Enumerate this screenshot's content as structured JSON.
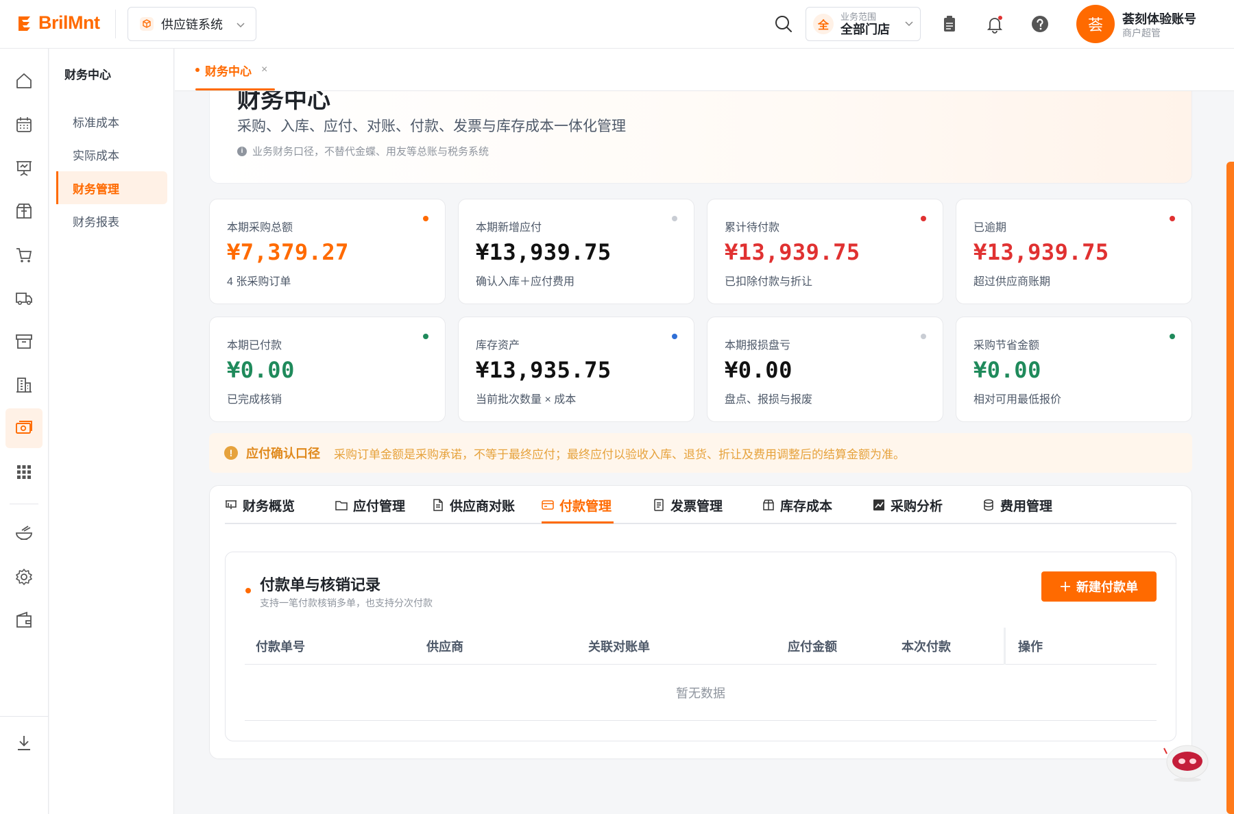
{
  "brand": {
    "name": "BrilMnt",
    "accent": "#ff6a00"
  },
  "header": {
    "system": "供应链系统",
    "scope_label": "业务范围",
    "scope_value": "全部门店",
    "scope_badge": "全",
    "user_avatar": "荟",
    "user_name": "荟刻体验账号",
    "user_role": "商户超管",
    "icons": [
      "search-icon",
      "clipboard-icon",
      "bell-icon",
      "help-icon"
    ]
  },
  "rail": {
    "items": [
      "home-icon",
      "calendar-icon",
      "presentation-icon",
      "package-icon",
      "cart-icon",
      "truck-icon",
      "archive-icon",
      "building-icon",
      "finance-icon",
      "apps-grid-icon",
      "bowl-icon",
      "settings-icon",
      "wallet-icon",
      "download-icon"
    ],
    "active": "finance-icon"
  },
  "subnav": {
    "title": "财务中心",
    "items": [
      {
        "label": "标准成本"
      },
      {
        "label": "实际成本"
      },
      {
        "label": "财务管理",
        "active": true
      },
      {
        "label": "财务报表"
      }
    ]
  },
  "page_tab": {
    "label": "财务中心",
    "close": "×"
  },
  "hero": {
    "title": "财务中心",
    "subtitle": "采购、入库、应付、对账、付款、发票与库存成本一体化管理",
    "note": "业务财务口径，不替代金蝶、用友等总账与税务系统"
  },
  "stats": [
    {
      "label": "本期采购总额",
      "value": "¥7,379.27",
      "desc": "4 张采购订单",
      "color": "#ff6a00",
      "dot": "#ff6a00"
    },
    {
      "label": "本期新增应付",
      "value": "¥13,939.75",
      "desc": "确认入库＋应付费用",
      "color": "#111111",
      "dot": "#c9cdd4"
    },
    {
      "label": "累计待付款",
      "value": "¥13,939.75",
      "desc": "已扣除付款与折让",
      "color": "#e03131",
      "dot": "#e03131"
    },
    {
      "label": "已逾期",
      "value": "¥13,939.75",
      "desc": "超过供应商账期",
      "color": "#e03131",
      "dot": "#e03131"
    },
    {
      "label": "本期已付款",
      "value": "¥0.00",
      "desc": "已完成核销",
      "color": "#1f8a5b",
      "dot": "#1f8a5b"
    },
    {
      "label": "库存资产",
      "value": "¥13,935.75",
      "desc": "当前批次数量 × 成本",
      "color": "#111111",
      "dot": "#2f6fd6"
    },
    {
      "label": "本期报损盘亏",
      "value": "¥0.00",
      "desc": "盘点、报损与报废",
      "color": "#111111",
      "dot": "#c9cdd4"
    },
    {
      "label": "采购节省金额",
      "value": "¥0.00",
      "desc": "相对可用最低报价",
      "color": "#1f8a5b",
      "dot": "#1f8a5b"
    }
  ],
  "alert": {
    "title": "应付确认口径",
    "text": "采购订单金额是采购承诺，不等于最终应付；最终应付以验收入库、退货、折让及费用调整后的结算金额为准。"
  },
  "tabs": [
    {
      "label": "财务概览",
      "icon": "presentation-icon"
    },
    {
      "label": "应付管理",
      "icon": "folder-icon"
    },
    {
      "label": "供应商对账",
      "icon": "document-icon"
    },
    {
      "label": "付款管理",
      "icon": "card-icon",
      "active": true
    },
    {
      "label": "发票管理",
      "icon": "invoice-icon"
    },
    {
      "label": "库存成本",
      "icon": "box-icon"
    },
    {
      "label": "采购分析",
      "icon": "chart-icon"
    },
    {
      "label": "费用管理",
      "icon": "database-icon"
    }
  ],
  "payments": {
    "title": "付款单与核销记录",
    "subtitle": "支持一笔付款核销多单，也支持分次付款",
    "new_button": "新建付款单",
    "columns": [
      "付款单号",
      "供应商",
      "关联对账单",
      "应付金额",
      "本次付款",
      "操作"
    ],
    "empty": "暂无数据"
  }
}
